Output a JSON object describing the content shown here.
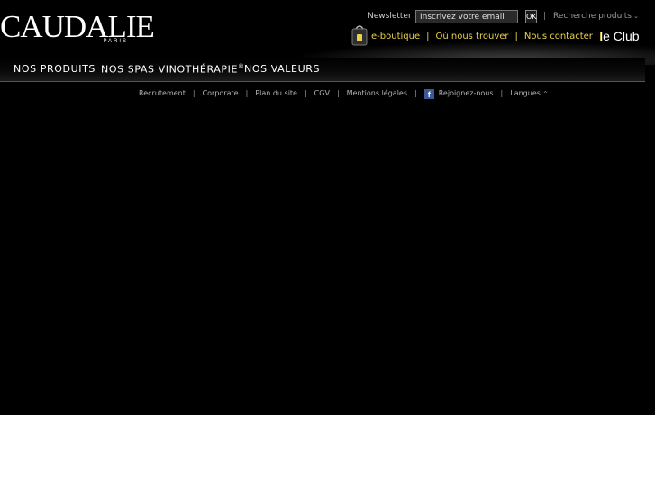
{
  "brand": {
    "name": "CAUDALIE",
    "subtitle": "PARIS"
  },
  "topbar": {
    "newsletter_label": "Newsletter",
    "newsletter_placeholder": "Inscrivez votre email",
    "ok_label": "OK",
    "separator": "|",
    "search_products_label": "Recherche produits",
    "search_products_chevron": "⌄"
  },
  "links": {
    "eboutique": "e-boutique",
    "store_locator": "Où nous trouver",
    "contact": "Nous contacter",
    "separator": "|",
    "le_club": "le Club"
  },
  "nav": {
    "products": "NOS PRODUITS",
    "spas": "NOS SPAS VINOTHÉRAPIE",
    "spas_sup": "®",
    "values": "NOS VALEURS"
  },
  "footer": {
    "items": [
      "Recrutement",
      "Corporate",
      "Plan du site",
      "CGV",
      "Mentions légales"
    ],
    "separator": "|",
    "facebook_icon_glyph": "f",
    "facebook_label": "Rejoignez-nous",
    "languages_label": "Langues",
    "languages_chevron": "^"
  },
  "colors": {
    "background": "#000000",
    "link_yellow": "#e8d24a",
    "page_bottom": "#ffffff",
    "facebook_blue": "#3b5998"
  },
  "icons": [
    "shopping-bag-icon",
    "facebook-icon",
    "chevron-down-icon",
    "chevron-up-icon"
  ]
}
